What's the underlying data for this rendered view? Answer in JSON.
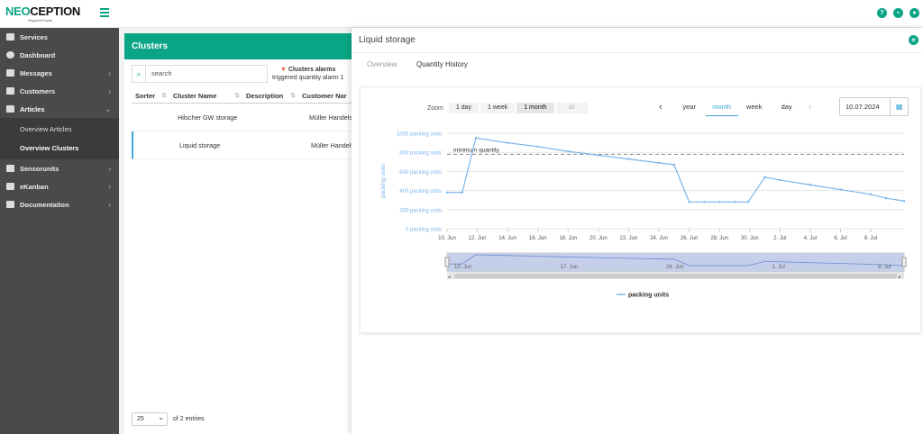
{
  "logo": {
    "brand_a": "NEO",
    "brand_b": "CEPTION",
    "tagline": "Pepperl+Fuchs"
  },
  "header": {
    "icons": [
      "help-icon",
      "cart-icon",
      "user-icon"
    ]
  },
  "sidebar": {
    "items": [
      {
        "label": "Services",
        "icon": "services-icon",
        "chevron": false
      },
      {
        "label": "Dashboard",
        "icon": "dashboard-icon",
        "chevron": false
      },
      {
        "label": "Messages",
        "icon": "envelope-icon",
        "chevron": true
      },
      {
        "label": "Customers",
        "icon": "users-icon",
        "chevron": true
      },
      {
        "label": "Articles",
        "icon": "tag-icon",
        "chevron": true,
        "expanded": true
      },
      {
        "label": "Sensorunits",
        "icon": "sensor-icon",
        "chevron": true
      },
      {
        "label": "eKanban",
        "icon": "kanban-icon",
        "chevron": true
      },
      {
        "label": "Documentation",
        "icon": "book-icon",
        "chevron": true
      }
    ],
    "sub_items": [
      {
        "label": "Overview Articles"
      },
      {
        "label": "Overview Clusters"
      }
    ]
  },
  "clusters": {
    "title": "Clusters",
    "search_placeholder": "search",
    "alarms_title": "Clusters alarms",
    "alarms_text": "triggered quantity alarm 1",
    "columns": [
      "Sorter",
      "Cluster Name",
      "Description",
      "Customer Nar"
    ],
    "rows": [
      {
        "name": "Hilscher GW storage",
        "customer": "Müller Handels"
      },
      {
        "name": "Liquid storage",
        "customer": "Müller Handels"
      }
    ],
    "page_size": "25",
    "entries_text": "of 2 entries"
  },
  "panel": {
    "title": "Liquid storage",
    "tabs": [
      "Overview",
      "Quantity History"
    ],
    "zoom_label": "Zoom",
    "zoom_options": [
      "1 day",
      "1 week",
      "1 month",
      "all"
    ],
    "zoom_selected": "1 month",
    "period_options": [
      "year",
      "month",
      "week",
      "day"
    ],
    "period_selected": "month",
    "date": "10.07.2024"
  },
  "chart_data": {
    "type": "line",
    "ylabel": "packing units",
    "y_ticks": [
      "1000 packing units",
      "800 packing units",
      "600 packing units",
      "400 packing units",
      "200 packing units",
      "0 packing units"
    ],
    "ylim": [
      0,
      1000
    ],
    "x_tick_labels": [
      "10. Jun",
      "12. Jun",
      "14. Jun",
      "16. Jun",
      "18. Jun",
      "20. Jun",
      "22. Jun",
      "24. Jun",
      "26. Jun",
      "28. Jun",
      "30. Jun",
      "2. Jul",
      "4. Jul",
      "6. Jul",
      "8. Jul"
    ],
    "x_range_days": [
      0,
      30.2
    ],
    "threshold": {
      "label": "minimum quantity",
      "value": 780
    },
    "series": [
      {
        "name": "packing units",
        "x": [
          0,
          1,
          1.9,
          4,
          6,
          8,
          10,
          12,
          14,
          15,
          16,
          17,
          18,
          19,
          19.9,
          21,
          22,
          24,
          26,
          28,
          29,
          30.2
        ],
        "y": [
          380,
          380,
          950,
          900,
          860,
          810,
          770,
          730,
          690,
          670,
          280,
          280,
          280,
          280,
          280,
          540,
          510,
          460,
          410,
          360,
          320,
          290
        ]
      }
    ],
    "navigator_labels": [
      "10. Jun",
      "17. Jun",
      "24. Jun",
      "1. Jul",
      "8. Jul"
    ],
    "legend": "packing units",
    "grid": true,
    "colors": {
      "line": "#7cb5ec",
      "threshold": "#888888",
      "navigator_fill": "#c5cfea"
    }
  }
}
